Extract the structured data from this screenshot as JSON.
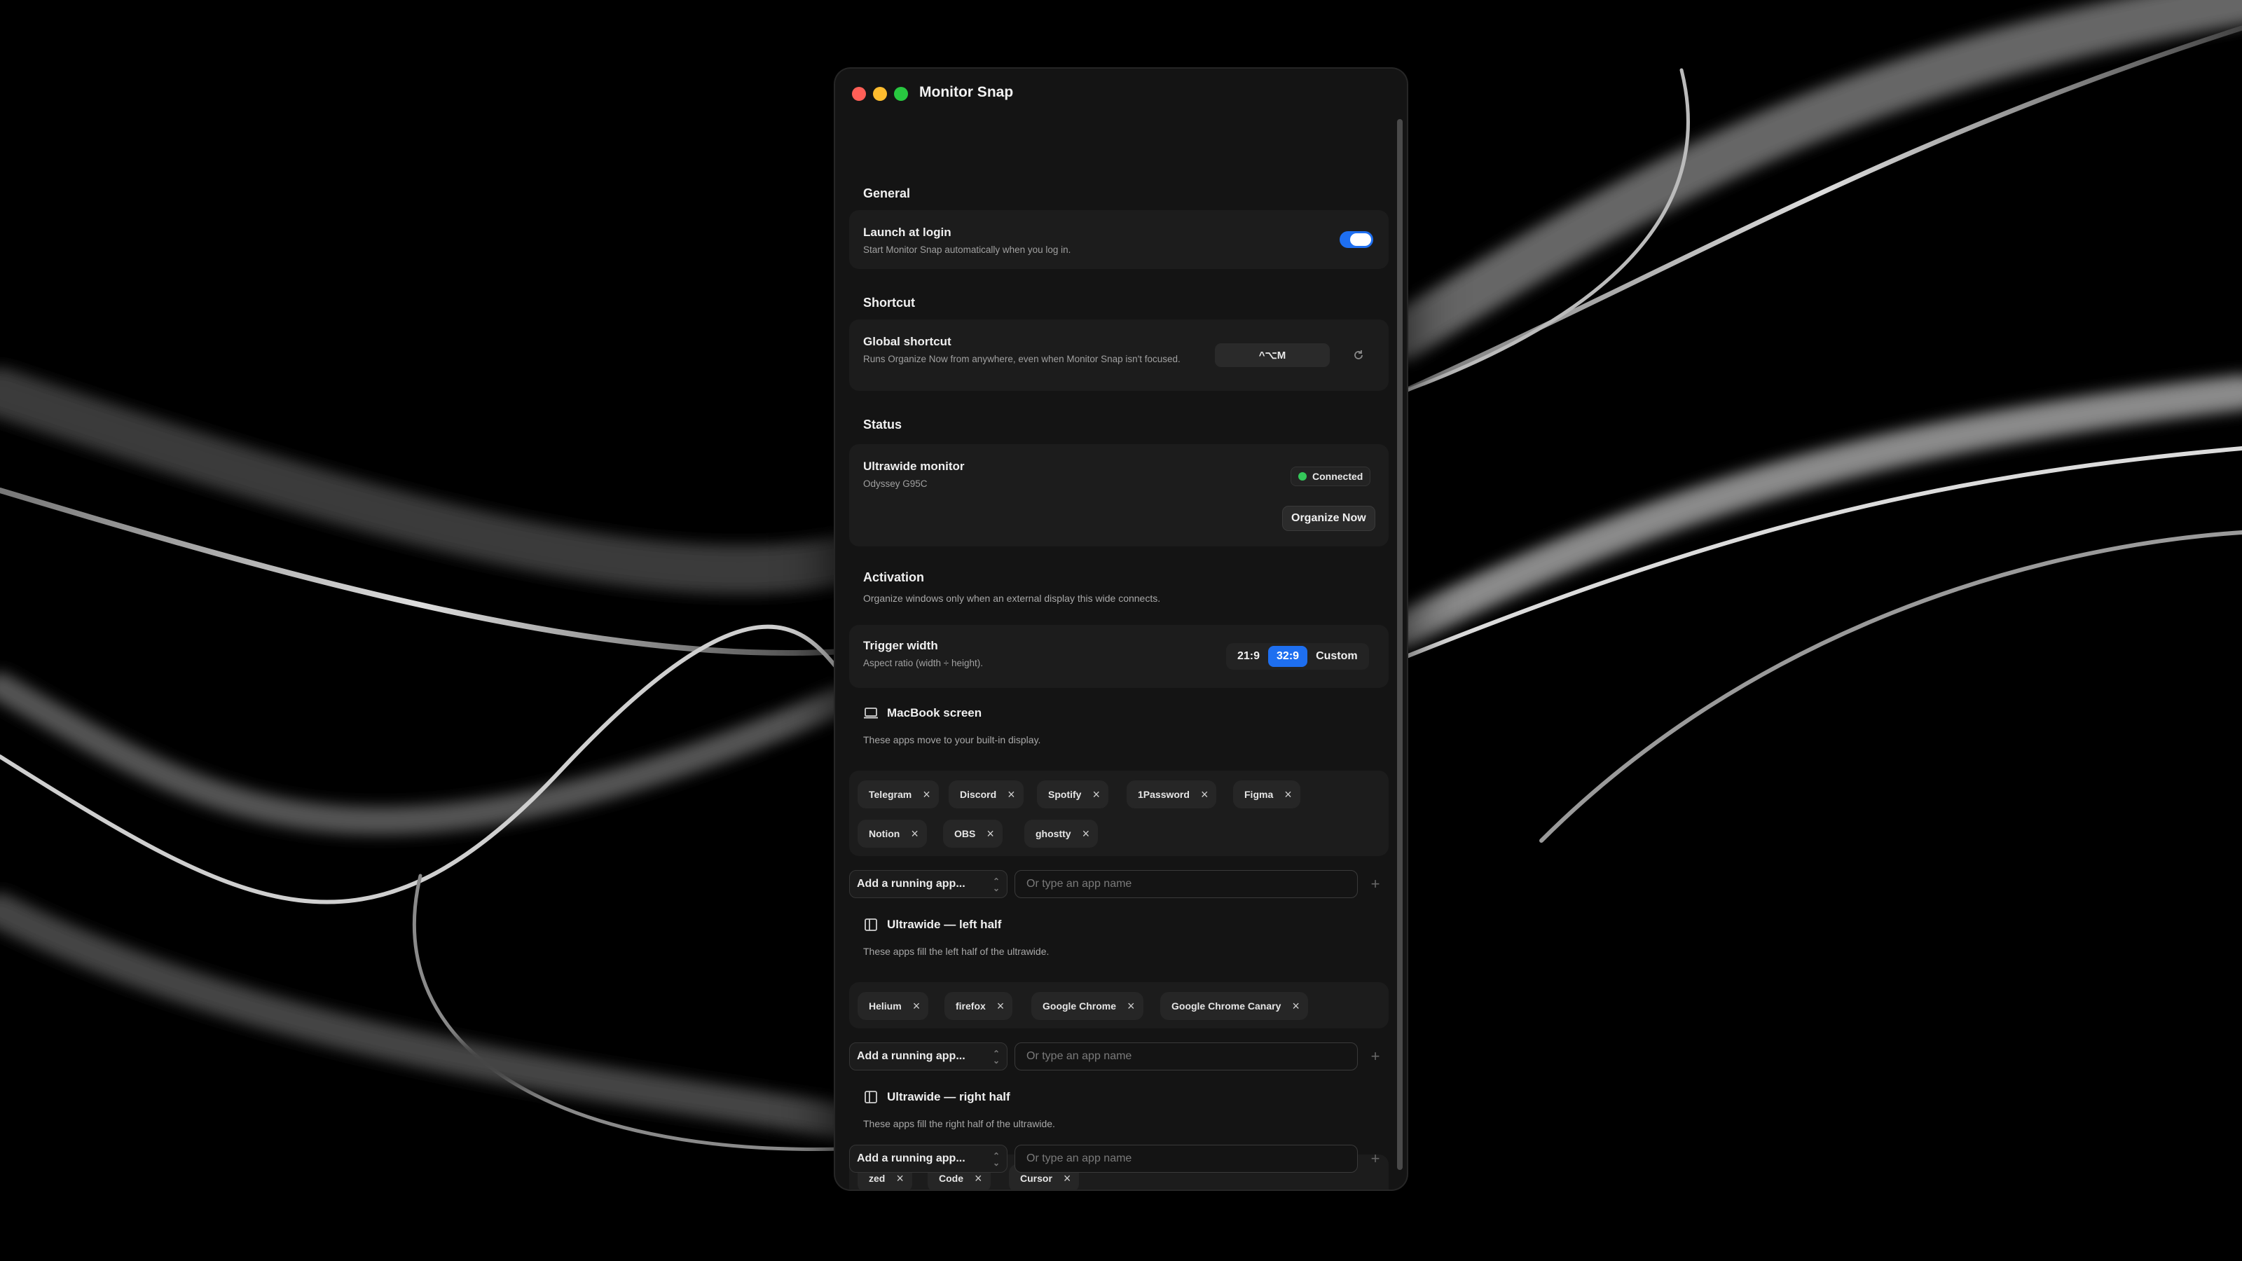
{
  "window": {
    "title": "Monitor Snap"
  },
  "general": {
    "heading": "General",
    "launch": {
      "title": "Launch at login",
      "subtitle": "Start Monitor Snap automatically when you log in.",
      "enabled": true
    }
  },
  "shortcut": {
    "heading": "Shortcut",
    "global": {
      "title": "Global shortcut",
      "subtitle": "Runs Organize Now from anywhere, even when Monitor Snap isn't focused.",
      "keys": "^⌥M"
    },
    "reset_icon": "reset-icon"
  },
  "status": {
    "heading": "Status",
    "monitor": {
      "title": "Ultrawide monitor",
      "subtitle": "Odyssey G95C",
      "badge": "Connected",
      "badge_color": "#34c759"
    },
    "organize_label": "Organize Now"
  },
  "activation": {
    "heading": "Activation",
    "description": "Organize windows only when an external display this wide connects.",
    "trigger": {
      "title": "Trigger width",
      "subtitle": "Aspect ratio (width ÷ height).",
      "options": [
        "21:9",
        "32:9",
        "Custom"
      ],
      "selected": "32:9"
    }
  },
  "groups": {
    "macbook": {
      "title": "MacBook screen",
      "icon": "laptop-icon",
      "description": "These apps move to your built-in display.",
      "apps": [
        "Telegram",
        "Discord",
        "Spotify",
        "1Password",
        "Figma",
        "Notion",
        "OBS",
        "ghostty"
      ],
      "select_label": "Add a running app...",
      "placeholder": "Or type an app name"
    },
    "left": {
      "title": "Ultrawide — left half",
      "icon": "split-left-icon",
      "description": "These apps fill the left half of the ultrawide.",
      "apps": [
        "Helium",
        "firefox",
        "Google Chrome",
        "Google Chrome Canary"
      ],
      "select_label": "Add a running app...",
      "placeholder": "Or type an app name"
    },
    "right": {
      "title": "Ultrawide — right half",
      "icon": "split-right-icon",
      "description": "These apps fill the right half of the ultrawide.",
      "apps": [
        "zed",
        "Code",
        "Cursor"
      ],
      "select_label": "Add a running app...",
      "placeholder": "Or type an app name"
    }
  },
  "colors": {
    "accent": "#1e6ff0",
    "window_bg": "#141414",
    "card_bg": "#1c1c1c"
  }
}
